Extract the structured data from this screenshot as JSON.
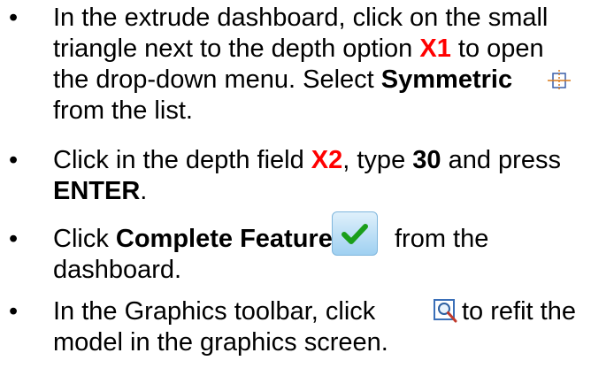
{
  "bullet_symbol": "•",
  "items": [
    {
      "lines": [
        {
          "parts": [
            "In the extrude dashboard, click on the small"
          ]
        },
        {
          "parts": [
            "triangle next to the depth option ",
            "X1",
            " to open"
          ]
        },
        {
          "parts": [
            "the drop-down menu.  Select ",
            "Symmetric",
            ""
          ]
        },
        {
          "parts": [
            "from the list."
          ]
        }
      ]
    },
    {
      "lines": [
        {
          "parts": [
            "Click in the depth field ",
            "X2",
            ", type ",
            "30",
            " and press"
          ]
        },
        {
          "parts": [
            "ENTER",
            "."
          ]
        }
      ]
    },
    {
      "lines": [
        {
          "parts": [
            "Click ",
            "Complete Feature",
            "",
            " from the"
          ]
        },
        {
          "parts": [
            "dashboard."
          ]
        }
      ]
    },
    {
      "lines": [
        {
          "parts": [
            "In the Graphics toolbar, click ",
            "",
            " to refit the"
          ]
        },
        {
          "parts": [
            "model in the graphics screen."
          ]
        }
      ]
    }
  ],
  "icons": {
    "symmetric": "symmetric-depth-icon",
    "complete": "complete-feature-check-icon",
    "refit": "refit-zoom-icon"
  },
  "colors": {
    "callout_red": "#ff0000",
    "check_green": "#1a9e1a"
  }
}
